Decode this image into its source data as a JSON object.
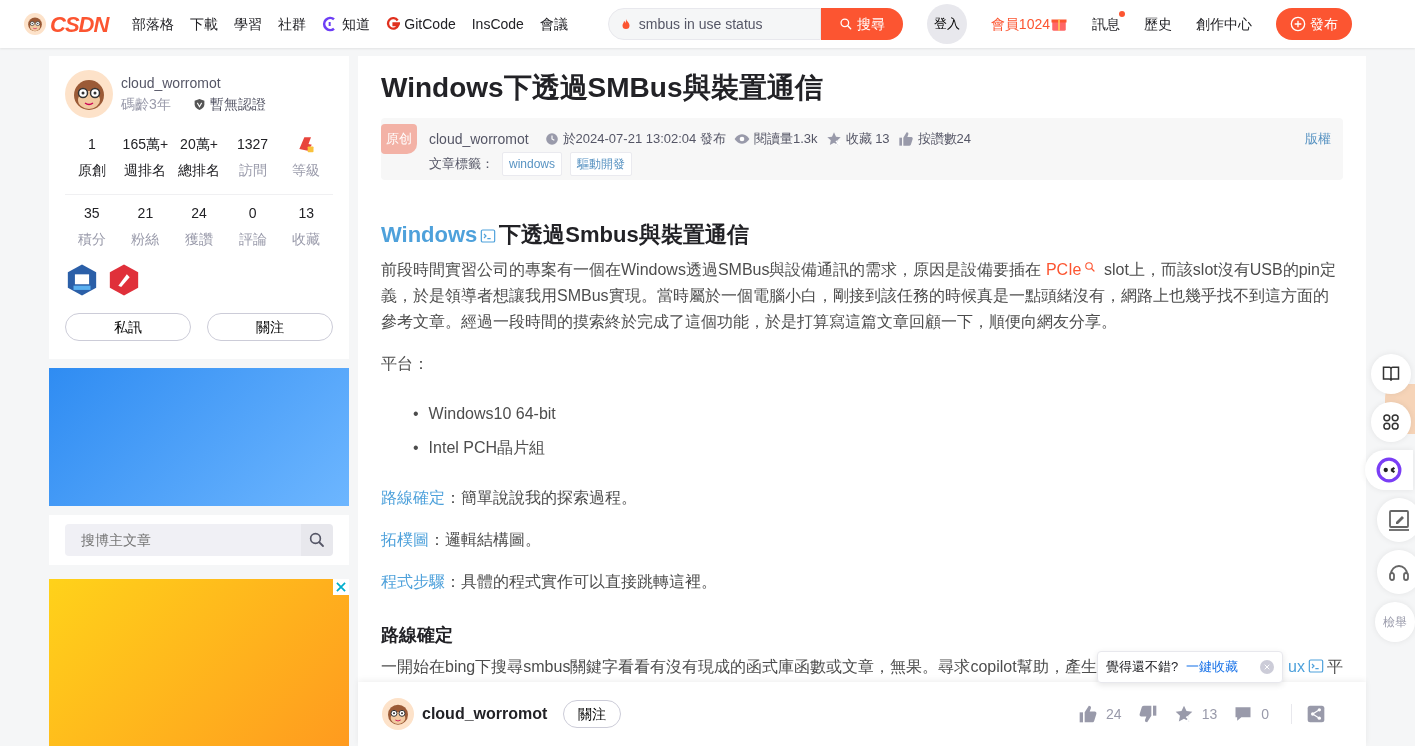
{
  "header": {
    "logo": "CSDN",
    "nav": [
      {
        "label": "部落格",
        "kind": "plain"
      },
      {
        "label": "下載",
        "kind": "plain"
      },
      {
        "label": "學習",
        "kind": "plain"
      },
      {
        "label": "社群",
        "kind": "plain"
      },
      {
        "label": "知道",
        "kind": "ai"
      },
      {
        "label": "GitCode",
        "kind": "git"
      },
      {
        "label": "InsCode",
        "kind": "plain"
      },
      {
        "label": "會議",
        "kind": "plain"
      }
    ],
    "search": {
      "value": "smbus in use status",
      "button": "搜尋"
    },
    "login": "登入",
    "vip": "會員1024",
    "links": [
      {
        "label": "訊息",
        "unread": true
      },
      {
        "label": "歷史",
        "unread": false
      },
      {
        "label": "創作中心",
        "unread": false
      }
    ],
    "publish": "發布"
  },
  "profile": {
    "name": "cloud_worromot",
    "years": "碼齡3年",
    "certification": "暫無認證",
    "stats_top": [
      {
        "kind": "number",
        "value": "1",
        "label": "原創",
        "emphasis": true
      },
      {
        "kind": "number",
        "value": "165萬+",
        "label": "週排名",
        "emphasis": true
      },
      {
        "kind": "number",
        "value": "20萬+",
        "label": "總排名",
        "emphasis": true
      },
      {
        "kind": "number",
        "value": "1327",
        "label": "訪問",
        "emphasis": false
      },
      {
        "kind": "level",
        "label": "等級",
        "emphasis": false
      }
    ],
    "stats_bottom": [
      {
        "value": "35",
        "label": "積分"
      },
      {
        "value": "21",
        "label": "粉絲"
      },
      {
        "value": "24",
        "label": "獲讚"
      },
      {
        "value": "0",
        "label": "評論"
      },
      {
        "value": "13",
        "label": "收藏"
      }
    ],
    "buttons": [
      "私訊",
      "關注"
    ]
  },
  "sidebar_search": {
    "placeholder": "搜博主文章"
  },
  "article": {
    "title": "Windows下透過SMBus與裝置通信",
    "meta": {
      "badge": "原创",
      "author": "cloud_worromot",
      "published": "於2024-07-21 13:02:04 發布",
      "views": "閱讀量1.3k",
      "favorites": "收藏 13",
      "likes": "按讚數24",
      "copyright": "版權",
      "tags_label": "文章標籤：",
      "tags": [
        "windows",
        "驅動開發"
      ]
    },
    "body": [
      {
        "kind": "heading2",
        "segments": [
          {
            "kind": "app_link",
            "text": "Windows"
          },
          {
            "kind": "text",
            "text": "下透過Smbus與裝置通信"
          }
        ]
      },
      {
        "kind": "paragraph",
        "segments": [
          {
            "kind": "text",
            "text": "前段時間實習公司的專案有一個在Windows透過SMBus與設備通訊的需求，原因是設備要插在 "
          },
          {
            "kind": "keyword",
            "text": "PCIe"
          },
          {
            "kind": "text",
            "text": " slot上，而該slot沒有USB的pin定義，於是領導者想讓我用SMBus實現。當時屬於一個電腦小白，剛接到該任務的時候真是一點頭緒沒有，網路上也幾乎找不到這方面的參考文章。經過一段時間的摸索終於完成了這個功能，於是打算寫這篇文章回顧一下，順便向網友分享。"
          }
        ]
      },
      {
        "kind": "paragraph",
        "segments": [
          {
            "kind": "text",
            "text": "平台："
          }
        ]
      },
      {
        "kind": "list",
        "items": [
          {
            "marker": "•",
            "text": "Windows10 64-bit"
          },
          {
            "marker": "•",
            "text": "Intel PCH晶片組"
          }
        ]
      },
      {
        "kind": "paragraph",
        "segments": [
          {
            "kind": "link",
            "text": "路線確定"
          },
          {
            "kind": "text",
            "text": "：簡單說說我的探索過程。"
          }
        ]
      },
      {
        "kind": "paragraph",
        "segments": [
          {
            "kind": "link",
            "text": "拓樸圖"
          },
          {
            "kind": "text",
            "text": "：邏輯結構圖。"
          }
        ]
      },
      {
        "kind": "paragraph",
        "segments": [
          {
            "kind": "link",
            "text": "程式步驟"
          },
          {
            "kind": "text",
            "text": "：具體的程式實作可以直接跳轉這裡。"
          }
        ]
      },
      {
        "kind": "heading3",
        "segments": [
          {
            "kind": "text",
            "text": "路線確定"
          }
        ]
      },
      {
        "kind": "split_paragraph",
        "left": [
          {
            "kind": "text",
            "text": "一開始在bing下搜尋smbus關鍵字看看有沒有現成的函式庫函數或文章，無果。尋求copilot幫助，產生"
          }
        ],
        "right": [
          {
            "kind": "app_link",
            "text": "ux"
          },
          {
            "kind": "text",
            "text": "平"
          }
        ]
      }
    ]
  },
  "tooltip": {
    "text": "覺得還不錯?",
    "action": "一鍵收藏"
  },
  "bottom_bar": {
    "author": "cloud_worromot",
    "follow": "關注",
    "actions": [
      {
        "kind": "like",
        "count": "24"
      },
      {
        "kind": "dislike"
      },
      {
        "kind": "favorite",
        "count": "13"
      },
      {
        "kind": "comment",
        "count": "0"
      },
      {
        "kind": "share"
      }
    ]
  },
  "right_toolbar": [
    {
      "kind": "book"
    },
    {
      "kind": "apps"
    },
    {
      "kind": "bot"
    },
    {
      "kind": "edit"
    },
    {
      "kind": "headset"
    },
    {
      "kind": "text",
      "label": "檢舉"
    }
  ]
}
